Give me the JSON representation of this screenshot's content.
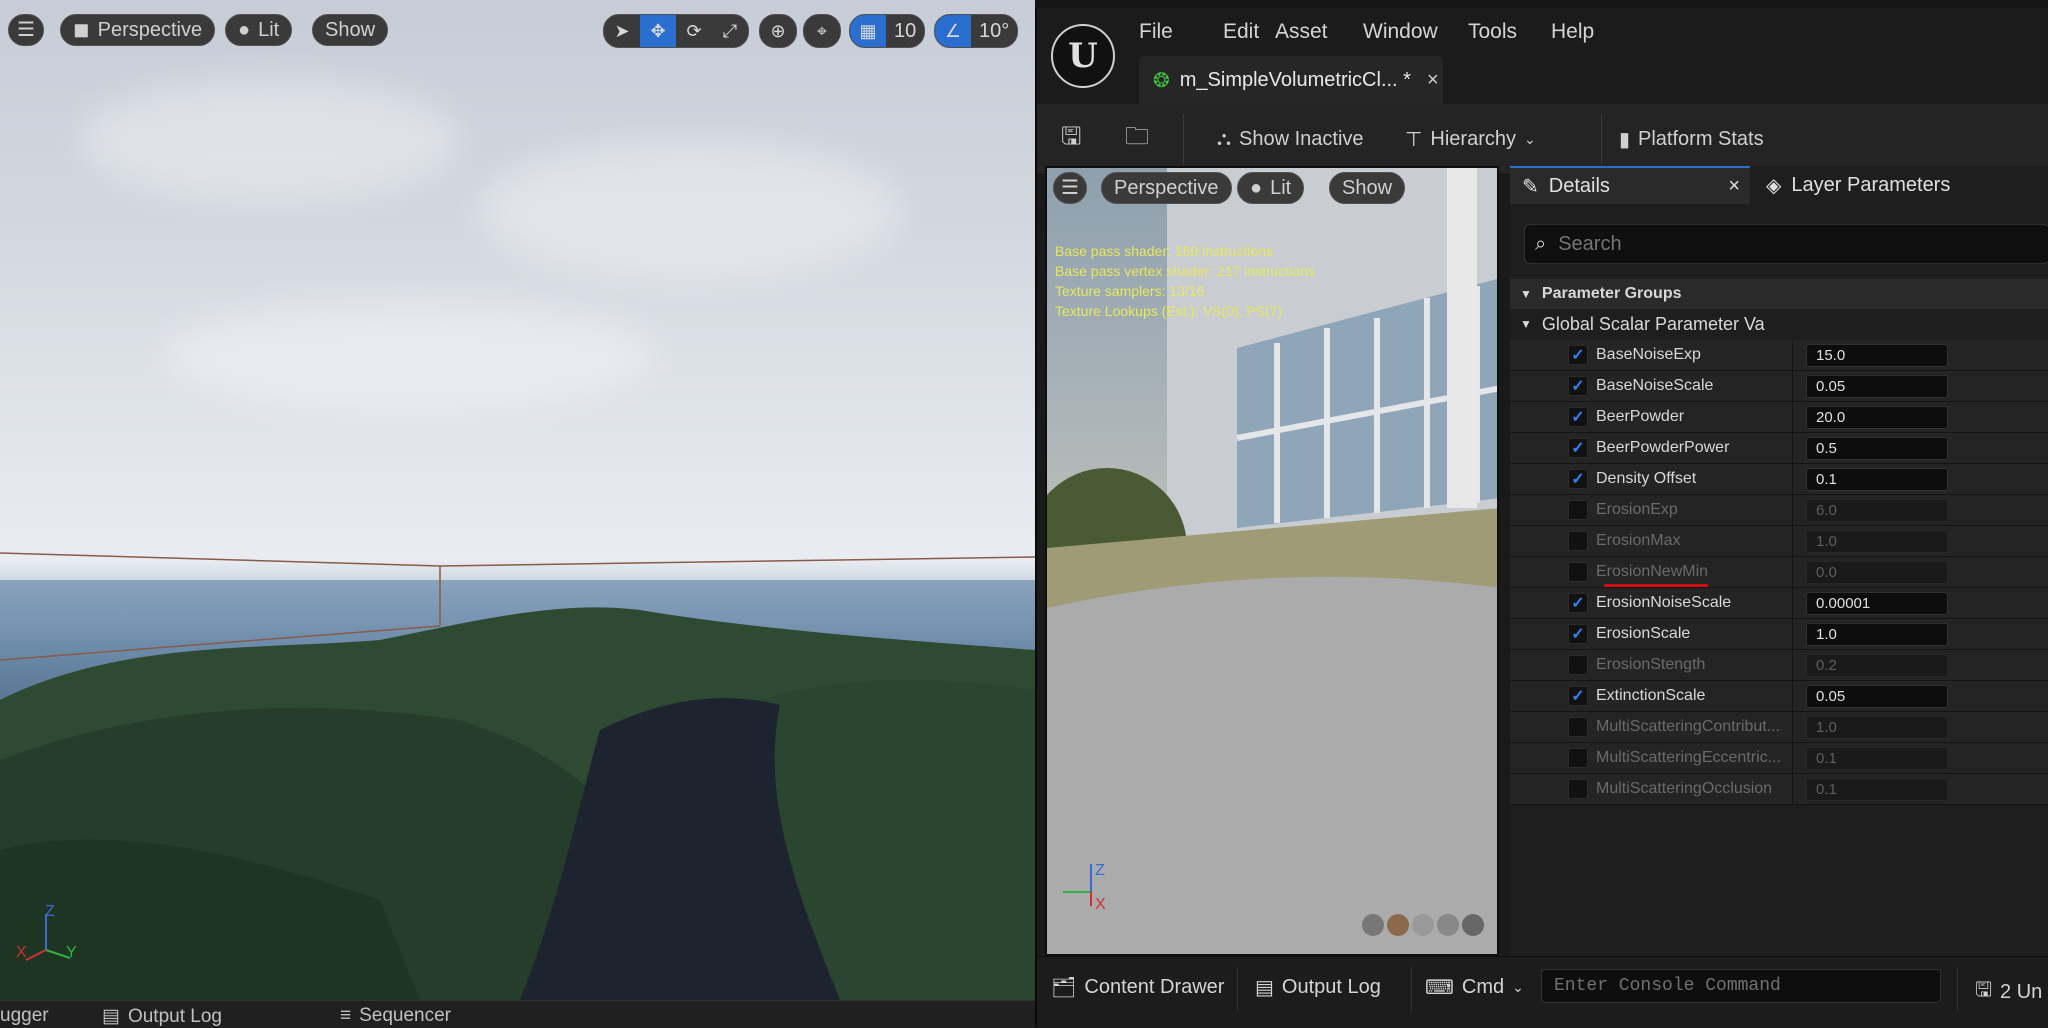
{
  "main_viewport": {
    "toolbar": {
      "perspective_label": "Perspective",
      "lit_label": "Lit",
      "show_label": "Show",
      "grid_value": "10",
      "angle_value": "10°"
    },
    "axis": {
      "x": "X",
      "y": "Y",
      "z": "Z"
    }
  },
  "bottom_strip": {
    "tabs": [
      "ugger",
      "Output Log",
      "Sequencer"
    ]
  },
  "editor": {
    "menu": [
      "File",
      "Edit",
      "Asset",
      "Window",
      "Tools",
      "Help"
    ],
    "document_tab": {
      "title": "m_SimpleVolumetricCl... *",
      "close": "×"
    },
    "toolbar": {
      "show_inactive": "Show Inactive",
      "hierarchy": "Hierarchy",
      "platform_stats": "Platform Stats"
    },
    "preview": {
      "perspective_label": "Perspective",
      "lit_label": "Lit",
      "show_label": "Show",
      "stats": [
        "Base pass shader: 169 instructions",
        "Base pass vertex shader: 217 instructions",
        "Texture samplers: 13/16",
        "Texture Lookups (Est.): VS(0), PS(7)"
      ],
      "axis": {
        "x": "X",
        "y": "Y",
        "z": "Z"
      }
    },
    "details": {
      "tab_details": "Details",
      "tab_details_close": "×",
      "tab_layer_params": "Layer Parameters",
      "search_placeholder": "Search",
      "group_header": "Parameter Groups",
      "subgroup_header": "Global Scalar Parameter Va",
      "params": [
        {
          "name": "BaseNoiseExp",
          "value": "15.0",
          "enabled": true
        },
        {
          "name": "BaseNoiseScale",
          "value": "0.05",
          "enabled": true
        },
        {
          "name": "BeerPowder",
          "value": "20.0",
          "enabled": true
        },
        {
          "name": "BeerPowderPower",
          "value": "0.5",
          "enabled": true
        },
        {
          "name": "Density Offset",
          "value": "0.1",
          "enabled": true
        },
        {
          "name": "ErosionExp",
          "value": "6.0",
          "enabled": false
        },
        {
          "name": "ErosionMax",
          "value": "1.0",
          "enabled": false
        },
        {
          "name": "ErosionNewMin",
          "value": "0.0",
          "enabled": false
        },
        {
          "name": "ErosionNoiseScale",
          "value": "0.00001",
          "enabled": true
        },
        {
          "name": "ErosionScale",
          "value": "1.0",
          "enabled": true
        },
        {
          "name": "ErosionStength",
          "value": "0.2",
          "enabled": false
        },
        {
          "name": "ExtinctionScale",
          "value": "0.05",
          "enabled": true
        },
        {
          "name": "MultiScatteringContribut...",
          "value": "1.0",
          "enabled": false
        },
        {
          "name": "MultiScatteringEccentric...",
          "value": "0.1",
          "enabled": false
        },
        {
          "name": "MultiScatteringOcclusion",
          "value": "0.1",
          "enabled": false
        }
      ]
    },
    "bottom_bar": {
      "content_drawer": "Content Drawer",
      "output_log": "Output Log",
      "cmd": "Cmd",
      "console_placeholder": "Enter Console Command",
      "unsaved": "2 Un"
    }
  },
  "colors": {
    "accent_blue": "#2a6fd0",
    "checkbox_blue": "#2f83f5",
    "stats_yellow": "#e8e85a",
    "annotation_red": "#d01010"
  }
}
